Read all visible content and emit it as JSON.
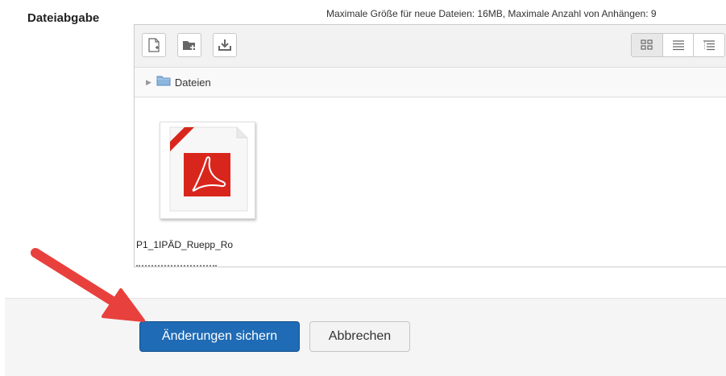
{
  "field": {
    "label": "Dateiabgabe",
    "limits_text": "Maximale Größe für neue Dateien: 16MB, Maximale Anzahl von Anhängen: 9"
  },
  "toolbar": {
    "icons": [
      "add-file-icon",
      "create-folder-icon",
      "download-icon"
    ],
    "views": [
      "icon-view-icon",
      "list-view-icon",
      "tree-view-icon"
    ]
  },
  "path": {
    "folder_name": "Dateien"
  },
  "files": [
    {
      "name_line1": "P1_1IPÄD_Ruepp_Ro",
      "type": "pdf"
    }
  ],
  "footer": {
    "save_label": "Änderungen sichern",
    "cancel_label": "Abbrechen"
  },
  "colors": {
    "primary_button": "#1f6bb5",
    "pdf_red": "#d9261c",
    "annotation_arrow": "#e8413d"
  }
}
